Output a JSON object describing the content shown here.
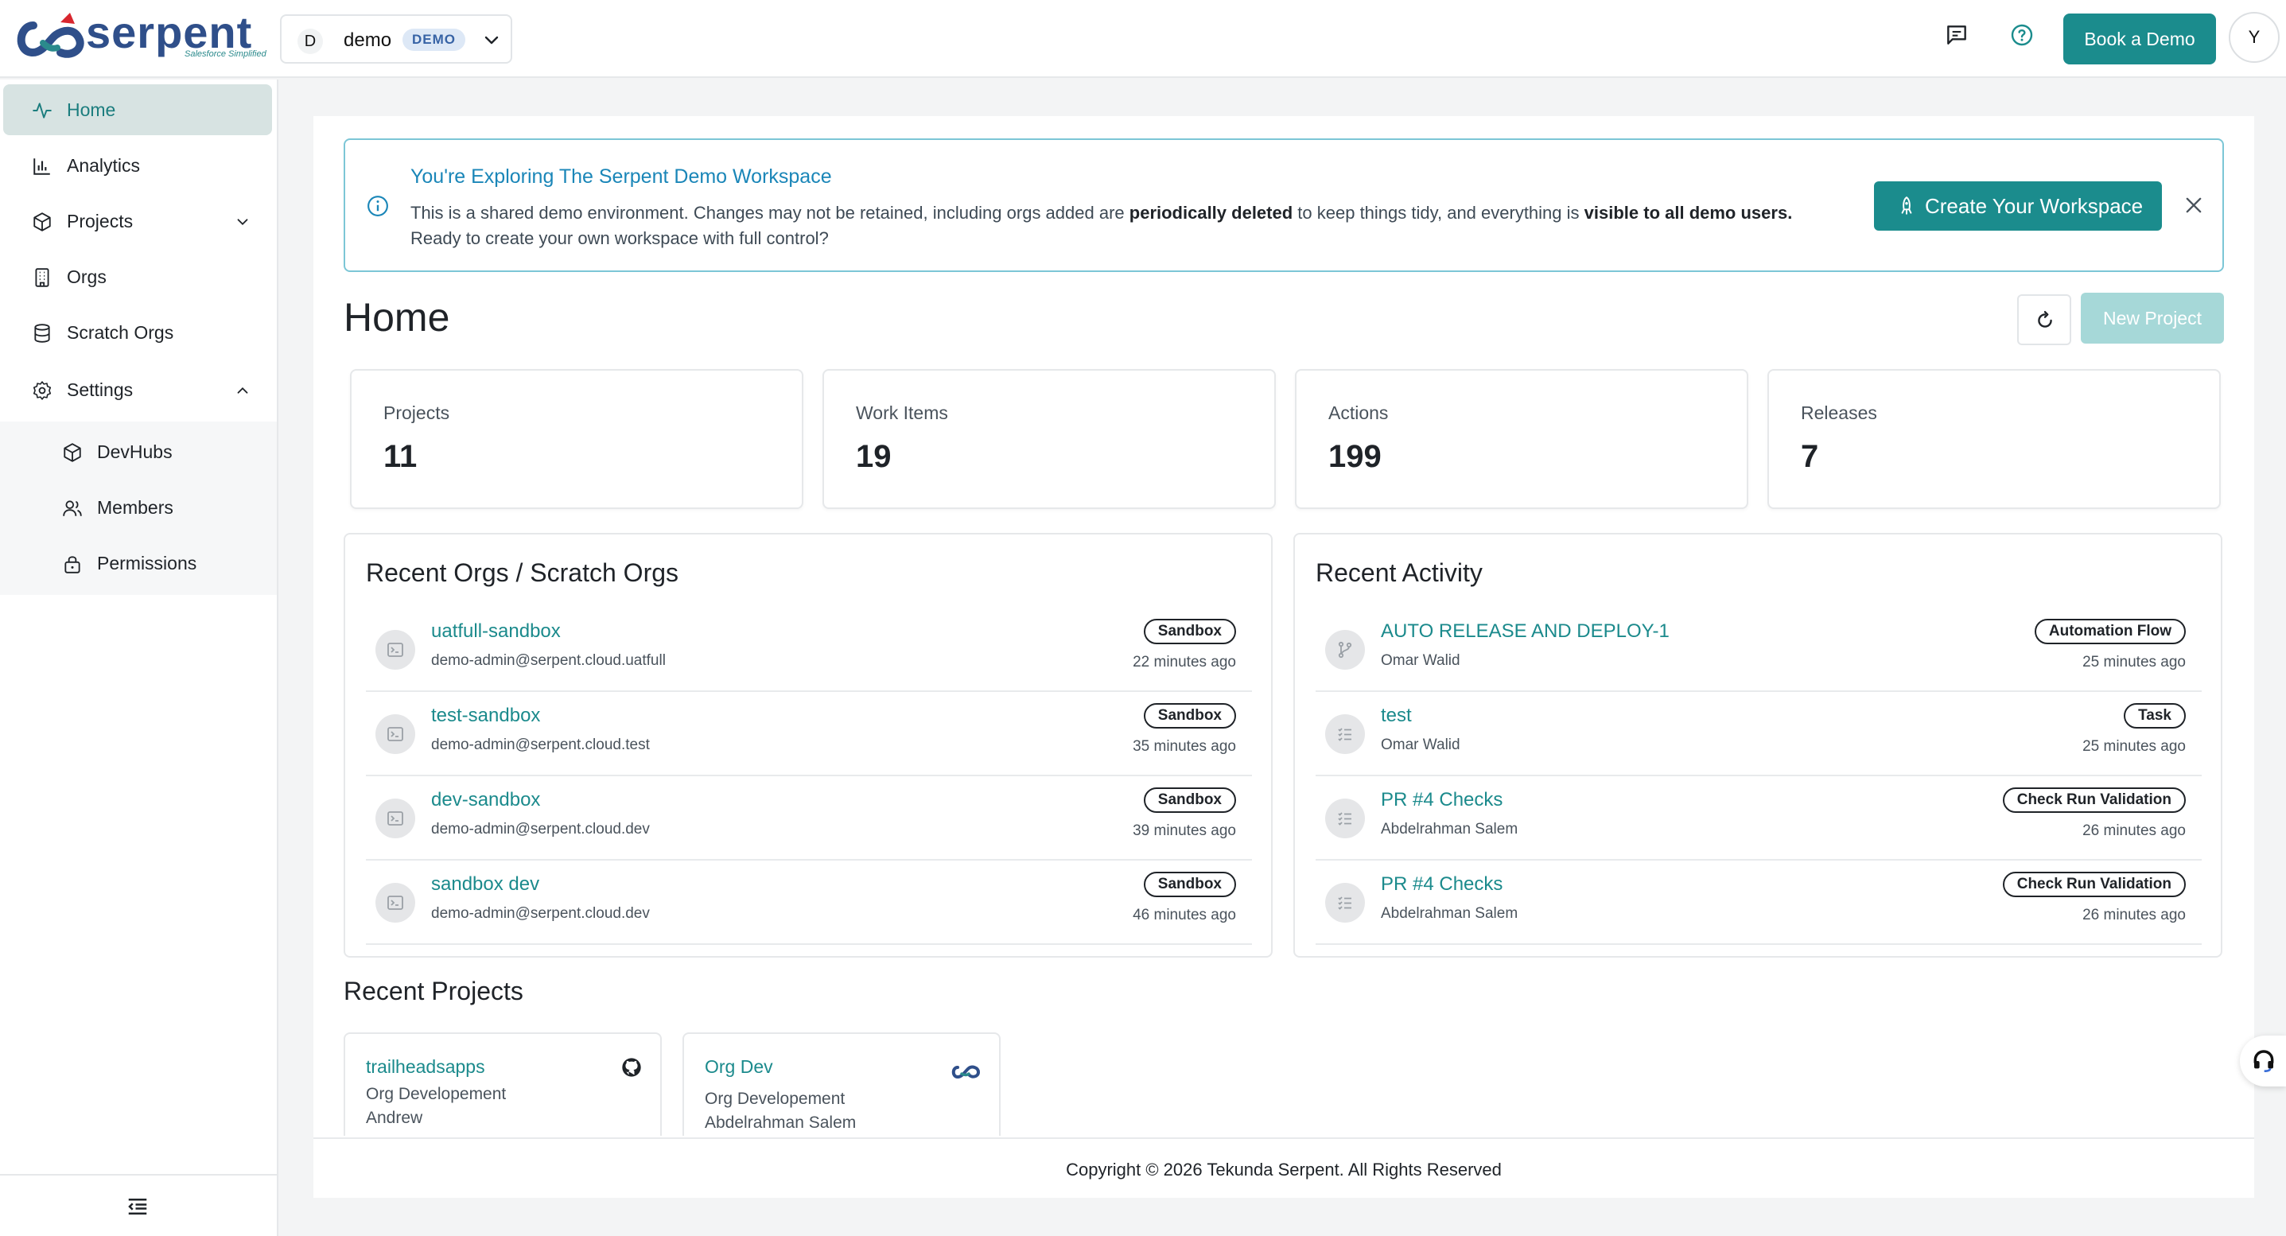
{
  "header": {
    "logo_text": "serpent",
    "logo_tagline": "Salesforce Simplified",
    "workspace": {
      "avatar": "D",
      "name": "demo",
      "badge": "DEMO"
    },
    "icons": [
      "chat-icon",
      "help-circle-icon"
    ],
    "book_demo_label": "Book a Demo",
    "user_avatar": "Y"
  },
  "sidebar": {
    "items": [
      {
        "label": "Home",
        "icon": "activity-icon",
        "active": true
      },
      {
        "label": "Analytics",
        "icon": "bar-chart-icon"
      },
      {
        "label": "Projects",
        "icon": "cube-icon",
        "expandable": true
      },
      {
        "label": "Orgs",
        "icon": "building-icon"
      },
      {
        "label": "Scratch Orgs",
        "icon": "database-icon"
      },
      {
        "label": "Settings",
        "icon": "gear-icon",
        "expanded": true
      }
    ],
    "settings_children": [
      {
        "label": "DevHubs",
        "icon": "cube-icon"
      },
      {
        "label": "Members",
        "icon": "users-icon"
      },
      {
        "label": "Permissions",
        "icon": "lock-icon"
      }
    ]
  },
  "banner": {
    "title": "You're Exploring The Serpent Demo Workspace",
    "text_1": "This is a shared demo environment. Changes may not be retained, including orgs added are ",
    "text_bold_1": "periodically deleted",
    "text_2": " to keep things tidy, and everything is ",
    "text_bold_2": "visible to all demo users.",
    "text_3": " Ready to create your own workspace with full control?",
    "button_label": "Create Your Workspace"
  },
  "page": {
    "title": "Home",
    "new_project_label": "New Project"
  },
  "stats": [
    {
      "label": "Projects",
      "value": "11"
    },
    {
      "label": "Work Items",
      "value": "19"
    },
    {
      "label": "Actions",
      "value": "199"
    },
    {
      "label": "Releases",
      "value": "7"
    }
  ],
  "recent_orgs": {
    "title": "Recent Orgs / Scratch Orgs",
    "rows": [
      {
        "name": "uatfull-sandbox",
        "user": "demo-admin@serpent.cloud.uatfull",
        "badge": "Sandbox",
        "time": "22 minutes ago"
      },
      {
        "name": "test-sandbox",
        "user": "demo-admin@serpent.cloud.test",
        "badge": "Sandbox",
        "time": "35 minutes ago"
      },
      {
        "name": "dev-sandbox",
        "user": "demo-admin@serpent.cloud.dev",
        "badge": "Sandbox",
        "time": "39 minutes ago"
      },
      {
        "name": "sandbox dev",
        "user": "demo-admin@serpent.cloud.dev",
        "badge": "Sandbox",
        "time": "46 minutes ago"
      }
    ]
  },
  "recent_activity": {
    "title": "Recent Activity",
    "rows": [
      {
        "name": "AUTO RELEASE AND DEPLOY-1",
        "user": "Omar Walid",
        "badge": "Automation Flow",
        "time": "25 minutes ago",
        "icon": "git-branch-icon"
      },
      {
        "name": "test",
        "user": "Omar Walid",
        "badge": "Task",
        "time": "25 minutes ago",
        "icon": "checklist-icon"
      },
      {
        "name": "PR #4 Checks",
        "user": "Abdelrahman Salem",
        "badge": "Check Run Validation",
        "time": "26 minutes ago",
        "icon": "checklist-icon"
      },
      {
        "name": "PR #4 Checks",
        "user": "Abdelrahman Salem",
        "badge": "Check Run Validation",
        "time": "26 minutes ago",
        "icon": "checklist-icon"
      }
    ]
  },
  "recent_projects": {
    "title": "Recent Projects",
    "cards": [
      {
        "name": "trailheadsapps",
        "type": "Org Developement",
        "owner": "Andrew",
        "icon": "github-icon"
      },
      {
        "name": "Org Dev",
        "type": "Org Developement",
        "owner": "Abdelrahman Salem",
        "icon": "serpent-logo-icon"
      }
    ]
  },
  "footer": {
    "text": "Copyright © 2026 Tekunda Serpent. All Rights Reserved"
  },
  "colors": {
    "accent": "#1b8c8d",
    "link": "#1b8a8c",
    "banner_title": "#1a86b8",
    "logo": "#2f4f8a"
  }
}
